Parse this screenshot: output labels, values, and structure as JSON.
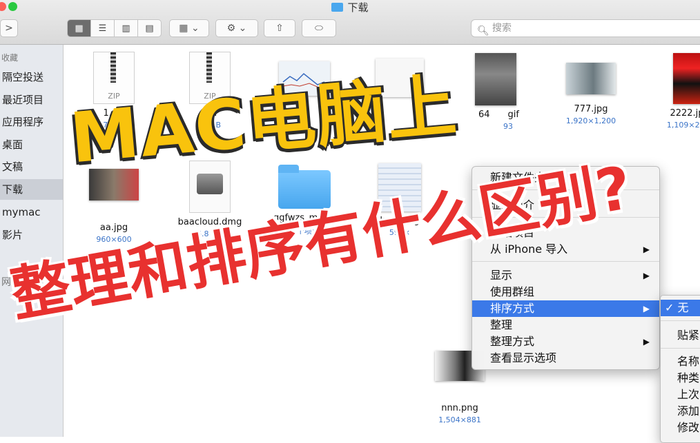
{
  "window": {
    "title": "下载"
  },
  "toolbar": {
    "back_label": ">",
    "view_modes": [
      "▦",
      "☰",
      "▥",
      "▤"
    ],
    "group_label": "▦ ⌄",
    "action_label": "⚙ ⌄",
    "share_label": "⇧",
    "tag_label": "⬭",
    "search_placeholder": "搜索"
  },
  "sidebar": {
    "section_head": "收藏",
    "items": [
      {
        "label": "隔空投送"
      },
      {
        "label": "最近项目"
      },
      {
        "label": "应用程序"
      },
      {
        "label": "桌面"
      },
      {
        "label": "文稿"
      },
      {
        "label": "下载"
      },
      {
        "label": "mymac"
      },
      {
        "label": "影片"
      }
    ],
    "section_head2": "网络"
  },
  "files": [
    {
      "name": "1.zip",
      "sub": "713.0"
    },
    {
      "name": "10.",
      "sub": "319.",
      "tail": "B"
    },
    {
      "name": "",
      "sub": ""
    },
    {
      "name": "",
      "sub": ""
    },
    {
      "name": "64",
      "tail": "gif",
      "sub": "",
      "sub_tail": "93"
    },
    {
      "name": "777.jpg",
      "sub": "1,920×1,200"
    },
    {
      "name": "2222.jp",
      "sub": "1,109×2,0"
    },
    {
      "name": "aa.jpg",
      "sub": "960×600"
    },
    {
      "name": "baacloud.dmg",
      "sub": "6.8 MB"
    },
    {
      "name": "ggfwzs_macw",
      "sub": "6 个项目"
    },
    {
      "name": "large.jpg",
      "sub": "597×"
    },
    {
      "name": "nnn.png",
      "sub": "1,504×881"
    }
  ],
  "context_menu": {
    "items": [
      {
        "label": "新建文件夹"
      },
      {
        "label": "显示简介"
      },
      {
        "label": "粘贴项目"
      },
      {
        "label": "从 iPhone 导入"
      },
      {
        "label": "显示"
      },
      {
        "label": "使用群组"
      },
      {
        "label": "排序方式"
      },
      {
        "label": "整理"
      },
      {
        "label": "整理方式"
      },
      {
        "label": "查看显示选项"
      }
    ]
  },
  "submenu": {
    "items": [
      {
        "label": "✓ 无"
      },
      {
        "label": "贴紧"
      },
      {
        "label": "名称"
      },
      {
        "label": "种类"
      },
      {
        "label": "上次"
      },
      {
        "label": "添加"
      },
      {
        "label": "修改"
      }
    ]
  },
  "overlay": {
    "line1": "MAC电脑上",
    "line2": "整理和排序有什么区别?"
  }
}
